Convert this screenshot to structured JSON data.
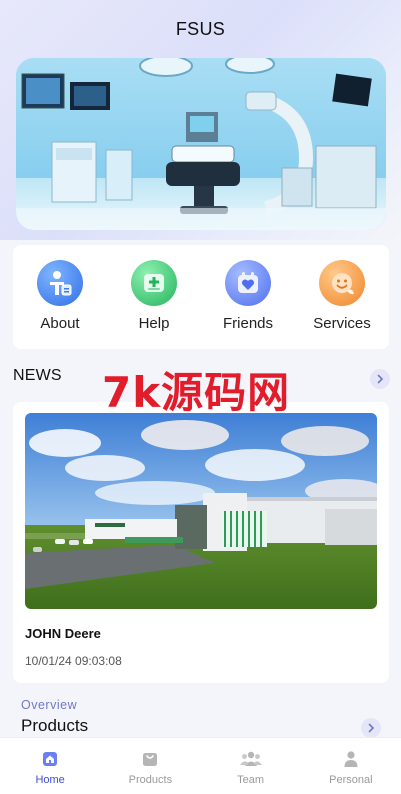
{
  "app": {
    "title": "FSUS"
  },
  "quick_links": [
    {
      "label": "About",
      "icon": "person-badge-icon",
      "color": "#3d7ff0"
    },
    {
      "label": "Help",
      "icon": "medical-kit-icon",
      "color": "#2fc46a"
    },
    {
      "label": "Friends",
      "icon": "heart-calendar-icon",
      "color": "#5a7ef0"
    },
    {
      "label": "Services",
      "icon": "smiley-icon",
      "color": "#f28b2c"
    }
  ],
  "news": {
    "section_title": "NEWS",
    "item": {
      "title": "JOHN Deere",
      "date": "10/01/24 09:03:08"
    }
  },
  "watermark": "7k源码网",
  "products": {
    "overview_label": "Overview",
    "title": "Products"
  },
  "tabbar": [
    {
      "label": "Home",
      "icon": "home-icon",
      "active": true
    },
    {
      "label": "Products",
      "icon": "bag-icon",
      "active": false
    },
    {
      "label": "Team",
      "icon": "team-icon",
      "active": false
    },
    {
      "label": "Personal",
      "icon": "person-icon",
      "active": false
    }
  ],
  "colors": {
    "accent": "#3d4fd9",
    "overview": "#6f79c8",
    "watermark": "#e11d2c"
  }
}
